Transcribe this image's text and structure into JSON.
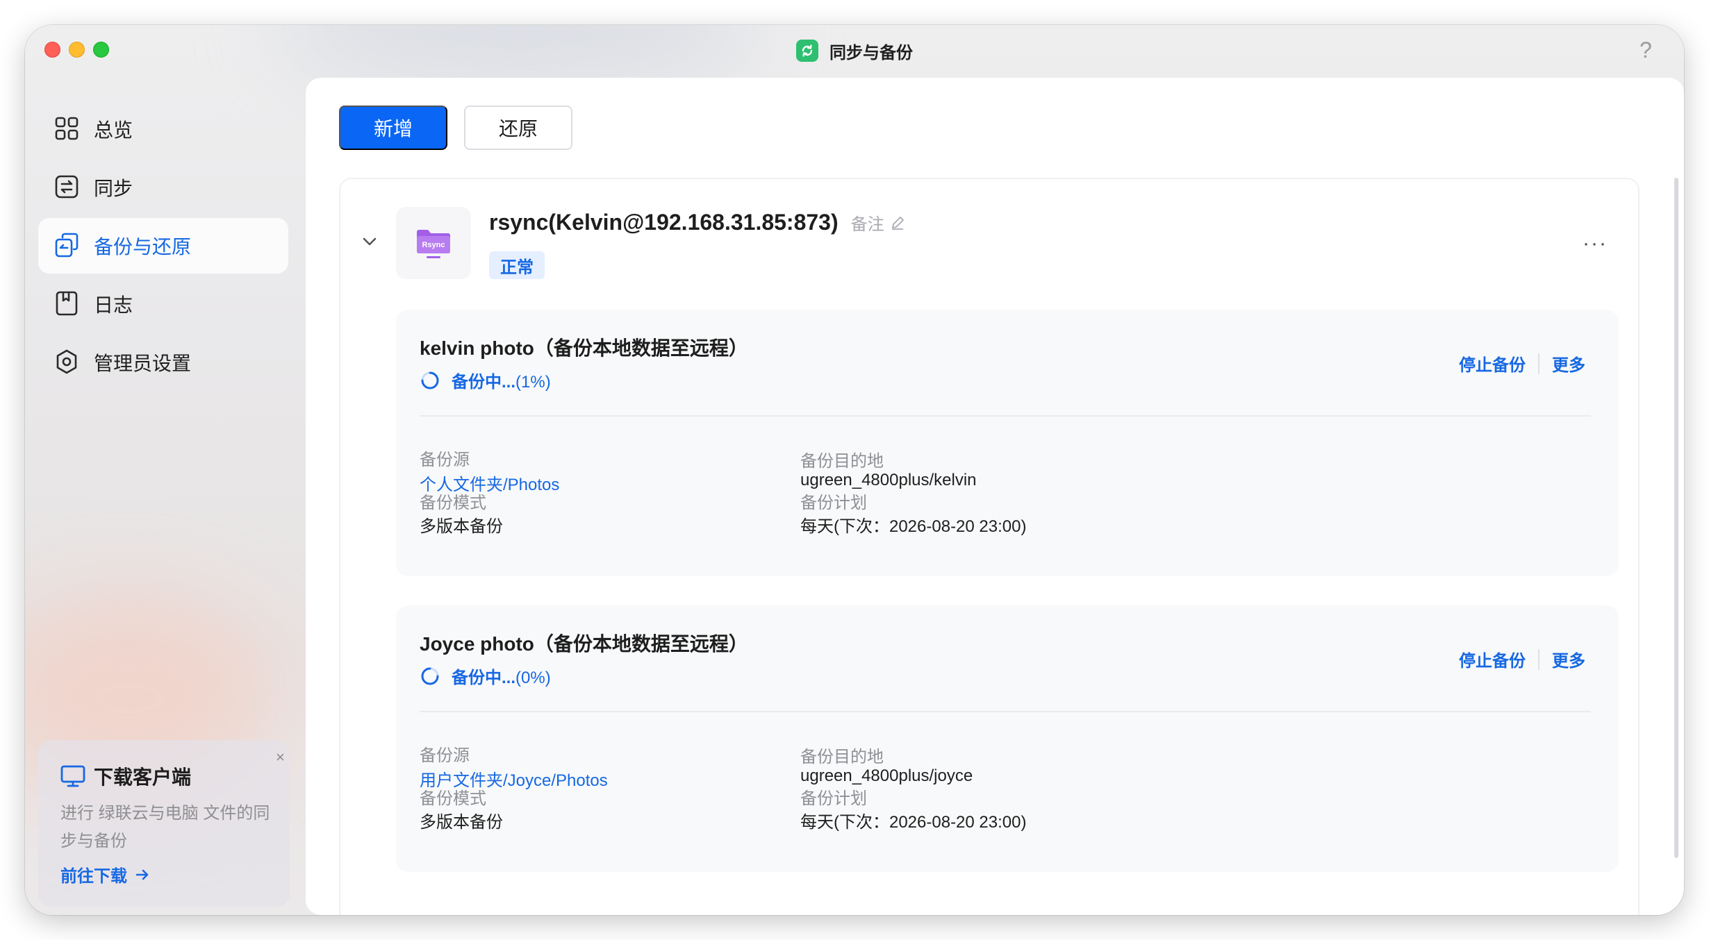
{
  "window": {
    "title": "同步与备份",
    "help": "?"
  },
  "sidebar": {
    "items": [
      {
        "label": "总览",
        "icon": "grid-icon",
        "active": false
      },
      {
        "label": "同步",
        "icon": "sync-icon",
        "active": false
      },
      {
        "label": "备份与还原",
        "icon": "backup-restore-icon",
        "active": true
      },
      {
        "label": "日志",
        "icon": "log-icon",
        "active": false
      },
      {
        "label": "管理员设置",
        "icon": "admin-settings-icon",
        "active": false
      }
    ],
    "download_card": {
      "title": "下载客户端",
      "description": "进行 绿联云与电脑 文件的同步与备份",
      "link": "前往下载",
      "close": "×"
    }
  },
  "toolbar": {
    "add_label": "新增",
    "restore_label": "还原"
  },
  "task": {
    "name": "rsync(Kelvin@192.168.31.85:873)",
    "note_label": "备注",
    "status": "正常",
    "more": "···",
    "icon_text": "Rsync",
    "jobs": [
      {
        "name": "kelvin photo（备份本地数据至远程）",
        "status_text": "备份中...",
        "progress": "(1%)",
        "progress_value": 0.01,
        "stop_label": "停止备份",
        "more_label": "更多",
        "source_label": "备份源",
        "source_value": "个人文件夹/Photos",
        "dest_label": "备份目的地",
        "dest_value": "ugreen_4800plus/kelvin",
        "mode_label": "备份模式",
        "mode_value": "多版本备份",
        "schedule_label": "备份计划",
        "schedule_value": "每天(下次：2026-08-20 23:00)"
      },
      {
        "name": "Joyce photo（备份本地数据至远程）",
        "status_text": "备份中...",
        "progress": "(0%)",
        "progress_value": 0.0,
        "stop_label": "停止备份",
        "more_label": "更多",
        "source_label": "备份源",
        "source_value": "用户文件夹/Joyce/Photos",
        "dest_label": "备份目的地",
        "dest_value": "ugreen_4800plus/joyce",
        "mode_label": "备份模式",
        "mode_value": "多版本备份",
        "schedule_label": "备份计划",
        "schedule_value": "每天(下次：2026-08-20 23:00)"
      }
    ]
  },
  "colors": {
    "accent": "#1668e3",
    "primary_button": "#0a66f5",
    "app_icon": "#2fbf71",
    "rsync_purple": "#a25ee8"
  }
}
